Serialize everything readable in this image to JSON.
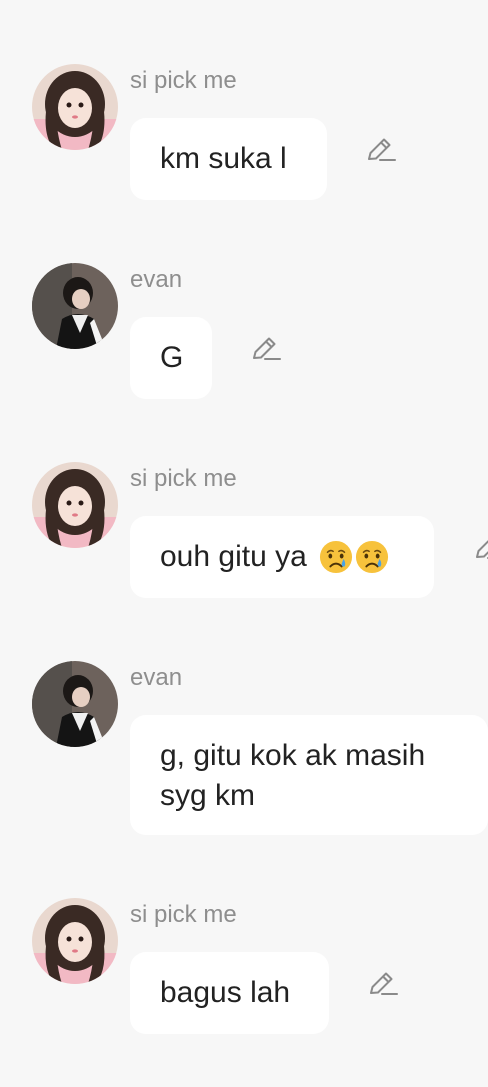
{
  "messages": [
    {
      "sender": "si pick me",
      "text": "km suka l",
      "avatar": "girl-avatar",
      "editable": true
    },
    {
      "sender": "evan",
      "text": "G",
      "avatar": "boy-avatar",
      "editable": true
    },
    {
      "sender": "si pick me",
      "text": "ouh gitu ya",
      "emojis": [
        "crying-face-emoji",
        "crying-face-emoji"
      ],
      "avatar": "girl-avatar",
      "editable": true
    },
    {
      "sender": "evan",
      "text": "g, gitu kok ak masih syg km",
      "avatar": "boy-avatar",
      "editable": false
    },
    {
      "sender": "si pick me",
      "text": "bagus lah",
      "avatar": "girl-avatar",
      "editable": true
    }
  ],
  "icons": {
    "edit": "pencil-icon",
    "emoji": "crying-face-emoji"
  },
  "colors": {
    "background": "#f7f7f7",
    "bubble": "#ffffff",
    "sender": "#8e8e8e",
    "text": "#222222",
    "icon": "#8a8a8a"
  }
}
